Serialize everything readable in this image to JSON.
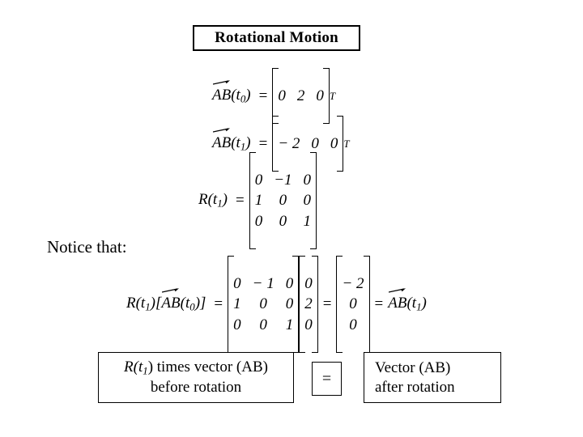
{
  "title": {
    "text": "Rotational Motion"
  },
  "equations": {
    "eq1": {
      "lhs_vector": "AB",
      "lhs_arg": "(t0)",
      "lhs_sub": "0",
      "equals": "=",
      "row_values": [
        "0",
        "2",
        "0"
      ],
      "transpose": "T"
    },
    "eq2": {
      "lhs_vector": "AB",
      "lhs_arg": "(t1)",
      "lhs_sub": "1",
      "equals": "=",
      "row_values": [
        "− 2",
        "0",
        "0"
      ],
      "transpose": "T"
    },
    "eq3": {
      "lhs_symbol": "R",
      "lhs_sub": "1",
      "lhs_arg_open": "(t",
      "lhs_arg_close": ")",
      "equals": "=",
      "matrix": [
        [
          "0",
          "−1",
          "0"
        ],
        [
          "1",
          "0",
          "0"
        ],
        [
          "0",
          "0",
          "1"
        ]
      ]
    },
    "eq4": {
      "lhs_symbol": "R",
      "lhs_sub": "1",
      "lhs_arg_open": "(t",
      "lhs_arg_close": ")[",
      "lhs_vector": "AB",
      "lhs_vector_arg": "(t",
      "lhs_vector_sub": "0",
      "lhs_vector_close": ")]",
      "equals1": "=",
      "matrix": [
        [
          "0",
          "− 1",
          "0"
        ],
        [
          "1",
          "0",
          "0"
        ],
        [
          "0",
          "0",
          "1"
        ]
      ],
      "column1": [
        "0",
        "2",
        "0"
      ],
      "equals2": "=",
      "column2": [
        "− 2",
        "0",
        "0"
      ],
      "equals3": "=",
      "rhs_vector": "AB",
      "rhs_arg": "(t",
      "rhs_sub": "1",
      "rhs_close": ")"
    }
  },
  "notice": {
    "text": "Notice that:"
  },
  "boxes": {
    "left": {
      "line1_pre": "R",
      "line1_sub": "1",
      "line1_mid": "(t",
      "line1_post": ") times vector (AB)",
      "line2": "before rotation"
    },
    "middle": {
      "text": "="
    },
    "right": {
      "line1": "Vector (AB)",
      "line2": "after rotation"
    }
  }
}
